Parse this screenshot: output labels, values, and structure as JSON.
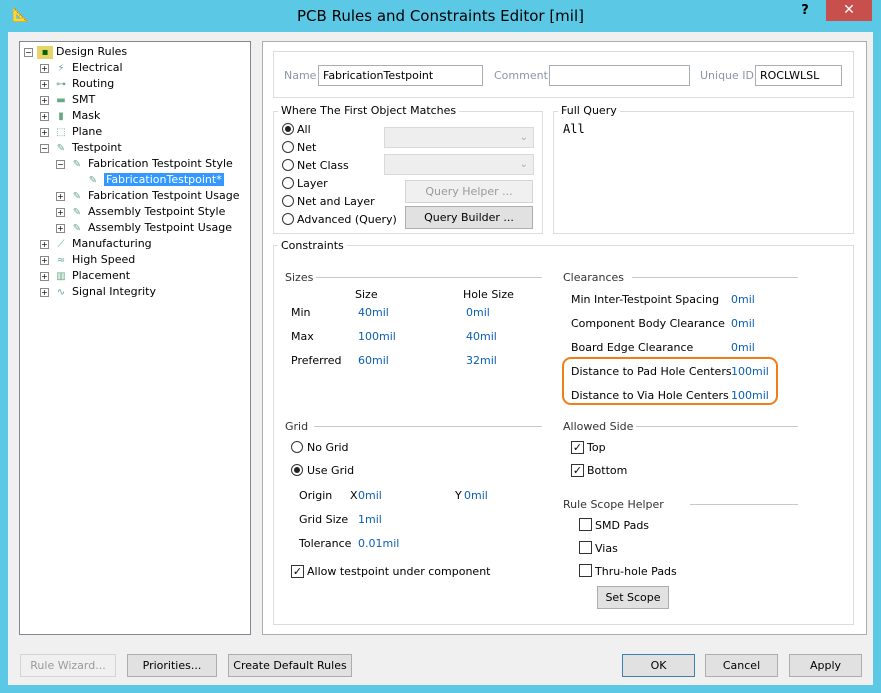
{
  "window": {
    "title": "PCB Rules and Constraints Editor [mil]",
    "help": "?",
    "close": "✕"
  },
  "tree": {
    "root": "Design Rules",
    "items": [
      {
        "label": "Electrical",
        "exp": "+"
      },
      {
        "label": "Routing",
        "exp": "+"
      },
      {
        "label": "SMT",
        "exp": "+"
      },
      {
        "label": "Mask",
        "exp": "+"
      },
      {
        "label": "Plane",
        "exp": "+"
      },
      {
        "label": "Testpoint",
        "exp": "−"
      },
      {
        "label": "Fabrication Testpoint Style",
        "exp": "−"
      },
      {
        "label": "FabricationTestpoint*",
        "exp": ""
      },
      {
        "label": "Fabrication Testpoint Usage",
        "exp": "+"
      },
      {
        "label": "Assembly Testpoint Style",
        "exp": "+"
      },
      {
        "label": "Assembly Testpoint Usage",
        "exp": "+"
      },
      {
        "label": "Manufacturing",
        "exp": "+"
      },
      {
        "label": "High Speed",
        "exp": "+"
      },
      {
        "label": "Placement",
        "exp": "+"
      },
      {
        "label": "Signal Integrity",
        "exp": "+"
      }
    ]
  },
  "rule": {
    "name_label": "Name",
    "name": "FabricationTestpoint",
    "comment_label": "Comment",
    "comment": "",
    "uid_label": "Unique ID",
    "uid": "ROCLWLSL"
  },
  "match": {
    "title": "Where The First Object Matches",
    "options": [
      "All",
      "Net",
      "Net Class",
      "Layer",
      "Net and Layer",
      "Advanced (Query)"
    ],
    "selected": "All",
    "query_helper": "Query Helper ...",
    "query_builder": "Query Builder ..."
  },
  "full_query": {
    "title": "Full Query",
    "text": "All"
  },
  "constraints": {
    "title": "Constraints",
    "sizes": {
      "title": "Sizes",
      "col_size": "Size",
      "col_hole": "Hole Size",
      "rows": [
        {
          "label": "Min",
          "size": "40mil",
          "hole": "0mil"
        },
        {
          "label": "Max",
          "size": "100mil",
          "hole": "40mil"
        },
        {
          "label": "Preferred",
          "size": "60mil",
          "hole": "32mil"
        }
      ]
    },
    "clearances": {
      "title": "Clearances",
      "rows": [
        {
          "label": "Min Inter-Testpoint Spacing",
          "value": "0mil"
        },
        {
          "label": "Component Body Clearance",
          "value": "0mil"
        },
        {
          "label": "Board Edge Clearance",
          "value": "0mil"
        },
        {
          "label": "Distance to Pad Hole Centers",
          "value": "100mil"
        },
        {
          "label": "Distance to Via Hole Centers",
          "value": "100mil"
        }
      ]
    },
    "grid": {
      "title": "Grid",
      "no_grid": "No Grid",
      "use_grid": "Use Grid",
      "origin_label": "Origin",
      "x_label": "X",
      "x": "0mil",
      "y_label": "Y",
      "y": "0mil",
      "size_label": "Grid Size",
      "size": "1mil",
      "tol_label": "Tolerance",
      "tol": "0.01mil",
      "allow_label": "Allow testpoint under component"
    },
    "allowed_side": {
      "title": "Allowed Side",
      "top": "Top",
      "bottom": "Bottom"
    },
    "scope": {
      "title": "Rule Scope Helper",
      "smd": "SMD Pads",
      "vias": "Vias",
      "thru": "Thru-hole Pads",
      "set_scope": "Set Scope"
    }
  },
  "buttons": {
    "wizard": "Rule Wizard...",
    "priorities": "Priorities...",
    "defaults": "Create Default Rules",
    "ok": "OK",
    "cancel": "Cancel",
    "apply": "Apply"
  },
  "accent": "#f07d1a"
}
